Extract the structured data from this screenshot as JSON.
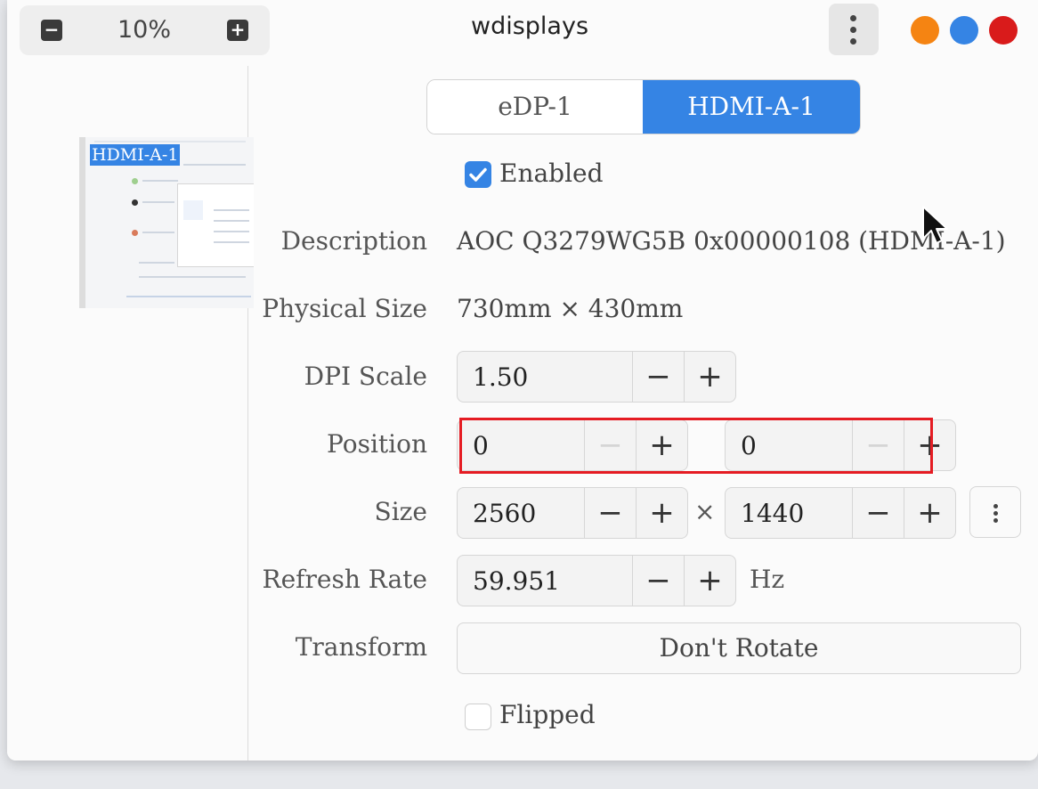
{
  "titlebar": {
    "zoom_level": "10%",
    "zoom_out_icon": "minus-icon",
    "zoom_in_icon": "plus-icon",
    "title": "wdisplays",
    "menu_icon": "vertical-dots-icon",
    "window_buttons": [
      {
        "name": "minimize",
        "color": "#f58412"
      },
      {
        "name": "maximize",
        "color": "#3584e4"
      },
      {
        "name": "close",
        "color": "#d91b1b"
      }
    ]
  },
  "preview": {
    "output_label": "HDMI-A-1"
  },
  "tabs": [
    {
      "label": "eDP-1",
      "active": false
    },
    {
      "label": "HDMI-A-1",
      "active": true
    }
  ],
  "enabled": {
    "label": "Enabled",
    "checked": true
  },
  "fields": {
    "description": {
      "label": "Description",
      "value": "AOC Q3279WG5B 0x00000108 (HDMI-A-1)"
    },
    "physical_size": {
      "label": "Physical Size",
      "value": "730mm × 430mm"
    },
    "dpi_scale": {
      "label": "DPI Scale",
      "value": "1.50"
    },
    "position": {
      "label": "Position",
      "x": "0",
      "y": "0"
    },
    "size": {
      "label": "Size",
      "width": "2560",
      "height": "1440",
      "separator": "×"
    },
    "refresh_rate": {
      "label": "Refresh Rate",
      "value": "59.951",
      "unit": "Hz"
    },
    "transform": {
      "label": "Transform",
      "value": "Don't Rotate"
    }
  },
  "flipped": {
    "label": "Flipped",
    "checked": false
  },
  "spin": {
    "minus": "−",
    "plus": "+"
  },
  "colors": {
    "accent": "#3584e4",
    "highlight": "#e51c23"
  }
}
